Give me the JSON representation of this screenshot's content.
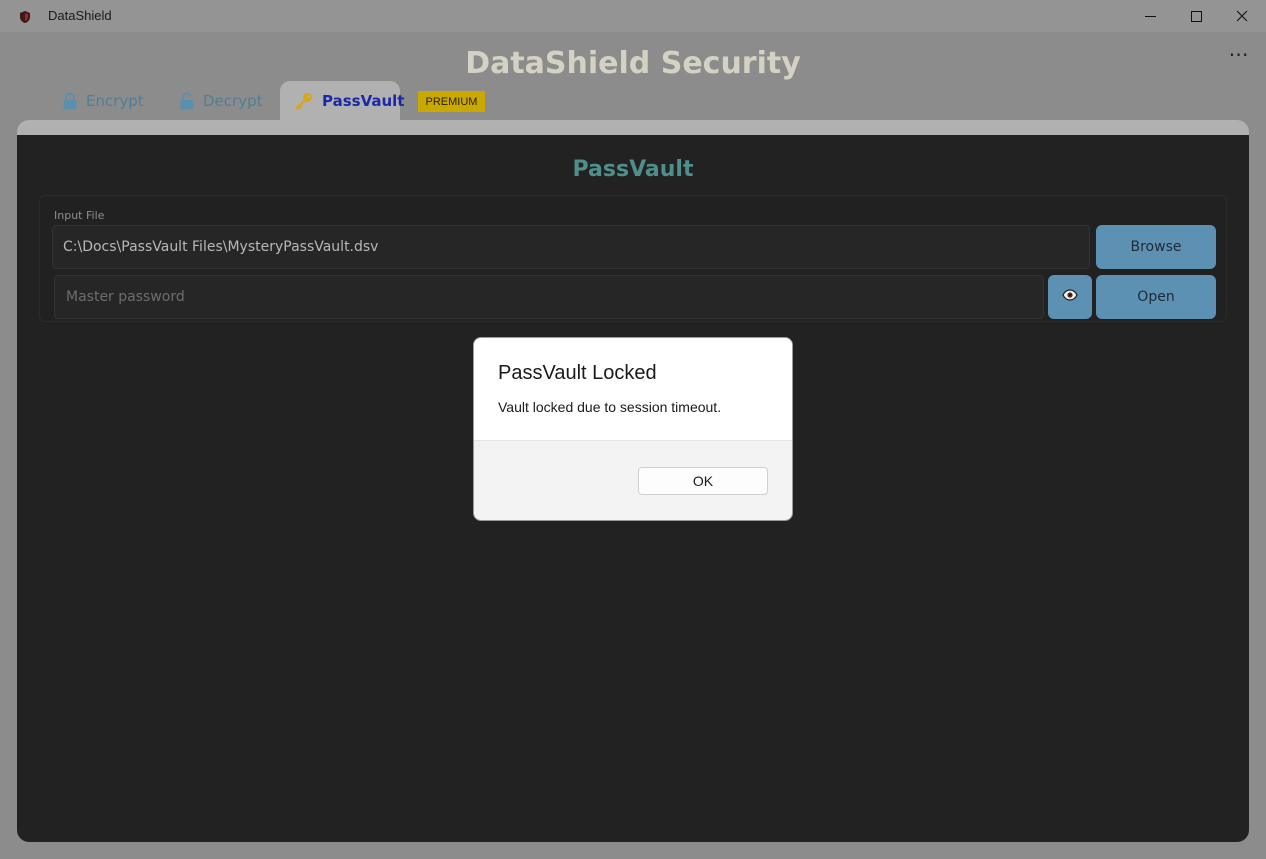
{
  "window": {
    "title": "DataShield",
    "controls": {
      "minimize_icon": "minimize-icon",
      "maximize_icon": "maximize-icon",
      "close_icon": "close-icon"
    }
  },
  "header": {
    "title": "DataShield Security",
    "more_menu": "⋯"
  },
  "tabs": [
    {
      "label": "Encrypt",
      "icon": "lock-icon",
      "active": false
    },
    {
      "label": "Decrypt",
      "icon": "unlock-icon",
      "active": false
    },
    {
      "label": "PassVault",
      "icon": "key-icon",
      "active": true
    }
  ],
  "premium_badge": "PREMIUM",
  "passvault": {
    "title": "PassVault",
    "input_file_label": "Input File",
    "input_file_value": "C:\\Docs\\PassVault Files\\MysteryPassVault.dsv",
    "master_password_placeholder": "Master password",
    "browse_label": "Browse",
    "open_label": "Open",
    "eye_icon": "eye-icon"
  },
  "dialog": {
    "title": "PassVault Locked",
    "message": "Vault locked due to session timeout.",
    "ok_label": "OK"
  },
  "colors": {
    "accent_blue": "#5d91b4",
    "active_tab_text": "#1c28a8",
    "premium": "#c9a900",
    "panel_title": "#4e8f8c"
  }
}
